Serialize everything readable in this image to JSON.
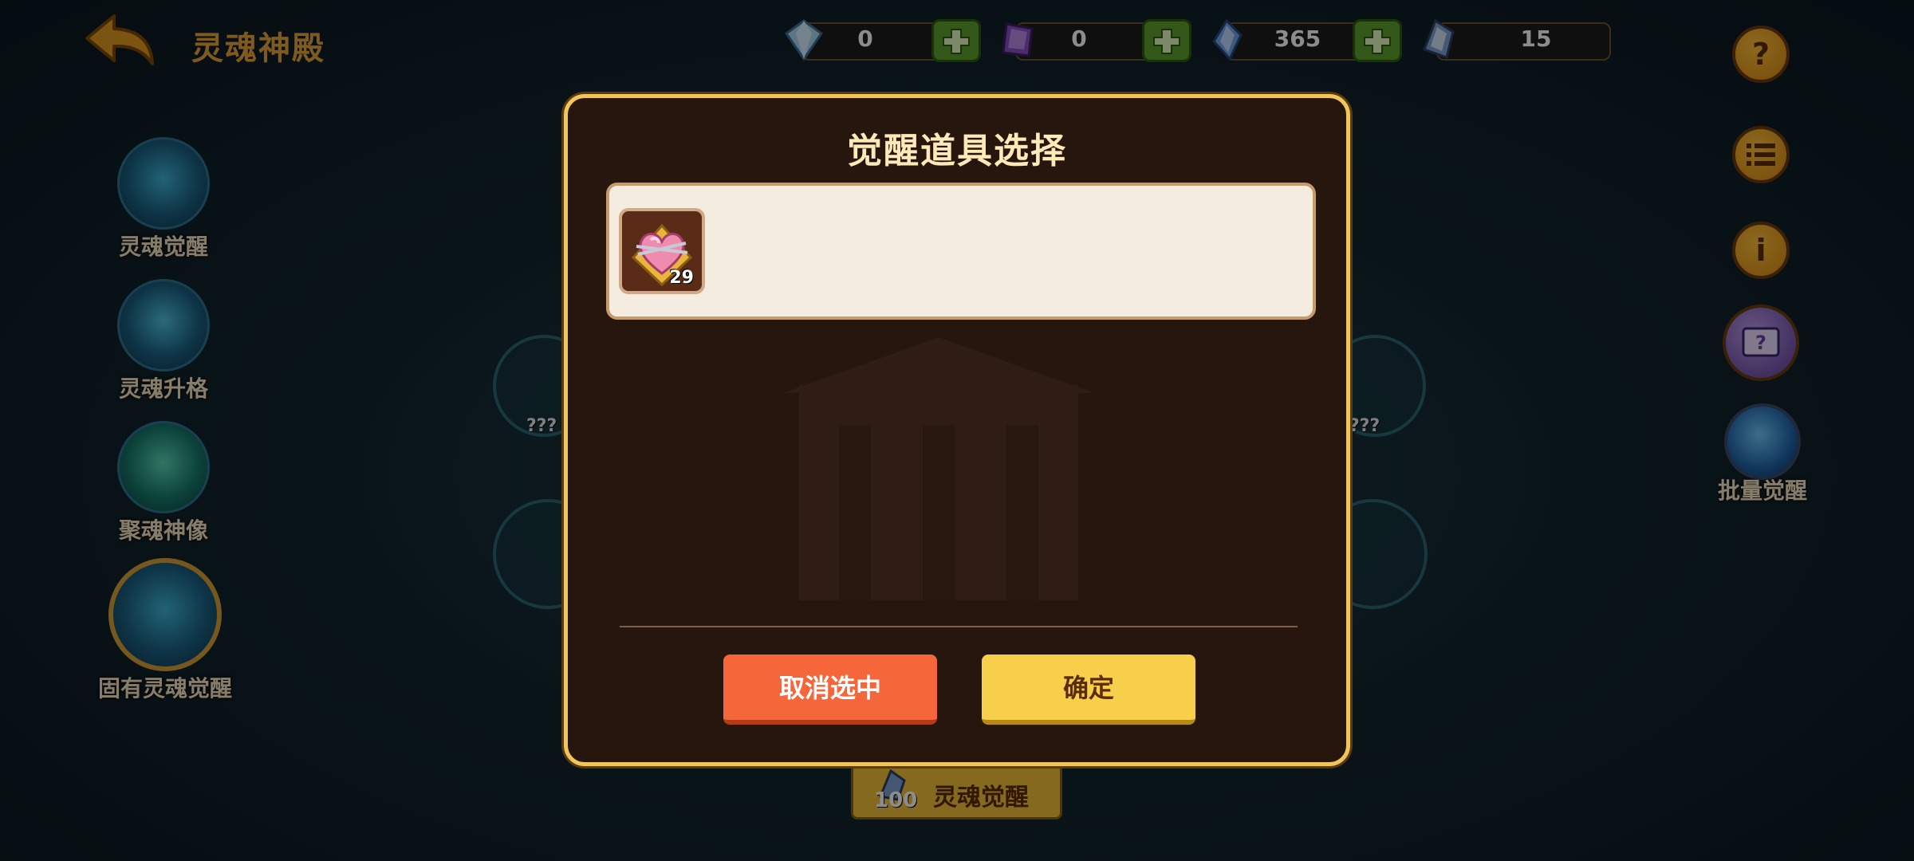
{
  "header": {
    "title": "灵魂神殿"
  },
  "currencies": [
    {
      "icon": "diamond-icon",
      "amount": "0",
      "has_plus": true
    },
    {
      "icon": "purple-crystal-icon",
      "amount": "0",
      "has_plus": true
    },
    {
      "icon": "blue-crystal-icon",
      "amount": "365",
      "has_plus": true
    },
    {
      "icon": "soul-crystal-icon",
      "amount": "15",
      "has_plus": false
    }
  ],
  "right_buttons": {
    "help": "?",
    "menu": "list-icon",
    "info": "i",
    "batch_label": "批量觉醒"
  },
  "left_menu": [
    {
      "label": "灵魂觉醒"
    },
    {
      "label": "灵魂升格"
    },
    {
      "label": "聚魂神像"
    },
    {
      "label": "固有灵魂觉醒"
    }
  ],
  "background": {
    "left_portrait_label": "???",
    "right_portrait_label": "???"
  },
  "bottom_button": {
    "cost": "100",
    "label": "灵魂觉醒"
  },
  "modal": {
    "title": "觉醒道具选择",
    "items": [
      {
        "icon": "heart-item-icon",
        "count": "29"
      }
    ],
    "cancel_label": "取消选中",
    "confirm_label": "确定"
  },
  "colors": {
    "modal_border": "#f0c55a",
    "modal_bg": "#27160e",
    "cancel_button": "#f5673a",
    "confirm_button": "#f7cf4a",
    "accent_gold": "#e8a53a"
  }
}
